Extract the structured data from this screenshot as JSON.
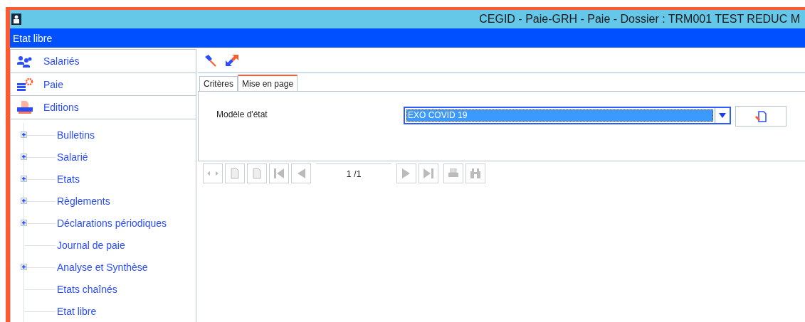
{
  "window": {
    "title": "CEGID - Paie-GRH - Paie - Dossier : TRM001 TEST REDUC M"
  },
  "screen_title": "Etat libre",
  "sidebar": {
    "sections": [
      {
        "label": "Salariés",
        "kind": "people"
      },
      {
        "label": "Paie",
        "kind": "payroll"
      },
      {
        "label": "Editions",
        "kind": "printer"
      }
    ],
    "tree": [
      {
        "label": "Bulletins",
        "expandable": true
      },
      {
        "label": "Salarié",
        "expandable": true
      },
      {
        "label": "Etats",
        "expandable": true
      },
      {
        "label": "Règlements",
        "expandable": true
      },
      {
        "label": "Déclarations périodiques",
        "expandable": true
      },
      {
        "label": "Journal de paie",
        "expandable": false
      },
      {
        "label": "Analyse et Synthèse",
        "expandable": true
      },
      {
        "label": "Etats chaînés",
        "expandable": false
      },
      {
        "label": "Etat libre",
        "expandable": false
      }
    ]
  },
  "tabs": [
    {
      "label": "Critères",
      "selected": false
    },
    {
      "label": "Mise en page",
      "selected": true
    }
  ],
  "form": {
    "label": "Modèle d'état",
    "value": "EXO COVID 19"
  },
  "pager": {
    "page": "1",
    "total": "/1"
  }
}
